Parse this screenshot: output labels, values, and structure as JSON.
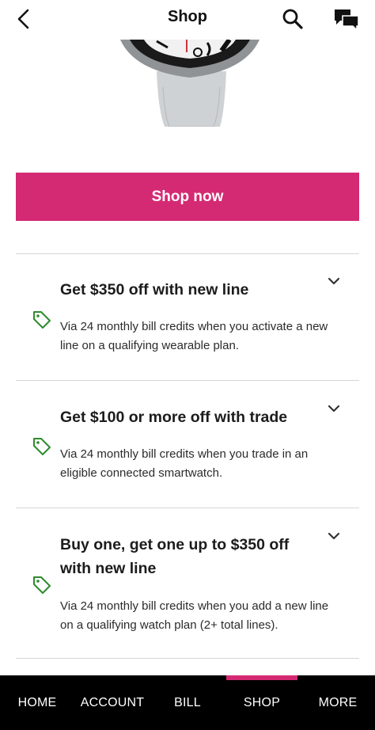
{
  "header": {
    "title": "Shop",
    "back_icon": "chevron-left-icon",
    "search_icon": "search-icon",
    "chat_icon": "chat-bubbles-icon"
  },
  "product": {
    "image": "smartwatch-image"
  },
  "cta": {
    "label": "Shop now",
    "color": "#d42a73"
  },
  "offers": [
    {
      "title": "Get $350 off with new line",
      "description": "Via 24 monthly bill credits when you activate a new line on a qualifying wearable plan.",
      "icon": "tag-icon",
      "toggle_icon": "chevron-down-icon"
    },
    {
      "title": "Get $100 or more off with trade",
      "description": "Via 24 monthly bill credits when you trade in an eligible connected smartwatch.",
      "icon": "tag-icon",
      "toggle_icon": "chevron-down-icon"
    },
    {
      "title": "Buy one, get one up to $350 off with new line",
      "description": "Via 24 monthly bill credits when you add a new line on a qualifying watch plan (2+ total lines).",
      "icon": "tag-icon",
      "toggle_icon": "chevron-down-icon"
    }
  ],
  "tabbar": {
    "items": [
      {
        "label": "HOME"
      },
      {
        "label": "ACCOUNT"
      },
      {
        "label": "BILL"
      },
      {
        "label": "SHOP"
      },
      {
        "label": "MORE"
      }
    ],
    "active": "SHOP",
    "accent": "#d42a73",
    "tag_color": "#2e8b2e"
  }
}
